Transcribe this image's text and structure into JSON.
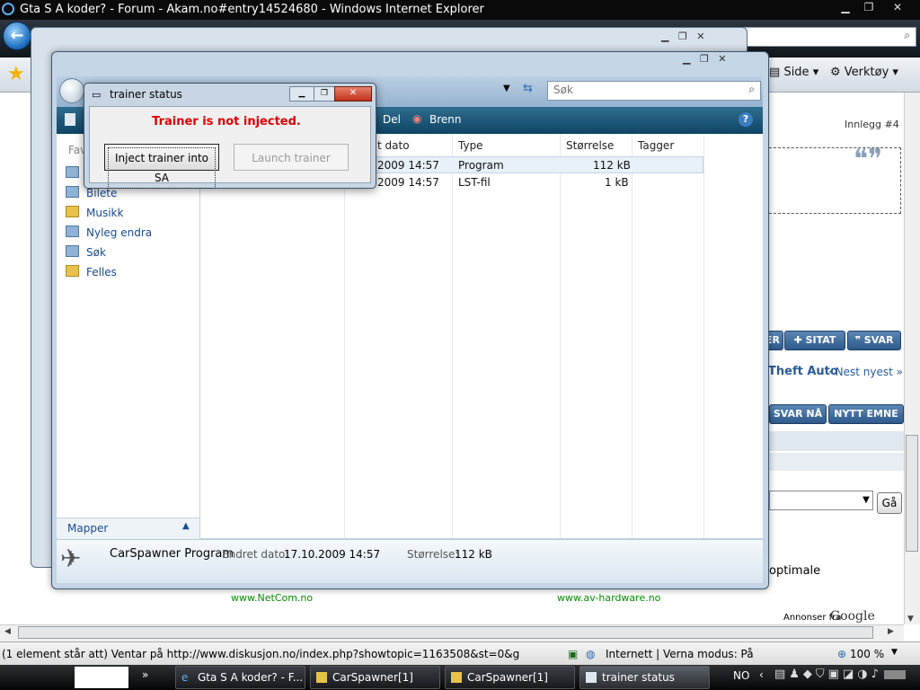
{
  "ie": {
    "title": "Gta S A koder? - Forum - Akam.no#entry14524680 - Windows Internet Explorer",
    "toolbar": {
      "side": "Side",
      "tools": "Verktøy"
    },
    "status_text": "(1 element står att) Ventar på http://www.diskusjon.no/index.php?showtopic=1163508&st=0&g",
    "zone": "Internett | Verna modus: På",
    "zoom": "100 %"
  },
  "page": {
    "innlegg": "Innlegg #4",
    "quote_label": "SITAT",
    "svar_label": "SVAR",
    "er_label": "ER",
    "theft_auto": "Theft Auto",
    "nest_nyest": "· Nest nyest »",
    "svar_na": "SVAR NÅ",
    "nytt_emne": "NYTT EMNE",
    "ga": "Gå",
    "optimale": "optimale",
    "netcom": "www.NetCom.no",
    "avhw": "www.av-hardware.no",
    "annonser": "Annonser fra",
    "google": "Google"
  },
  "explorer": {
    "search_placeholder": "Søk",
    "cmd": {
      "del": "Del",
      "brenn": "Brenn"
    },
    "nav": [
      "Bilete",
      "Musikk",
      "Nyleg endra",
      "Søk",
      "Felles"
    ],
    "nav_fav": "Fav",
    "mapper": "Mapper",
    "columns": [
      "t dato",
      "Type",
      "Størrelse",
      "Tagger"
    ],
    "rows": [
      {
        "date": "2009 14:57",
        "type": "Program",
        "size": "112 kB"
      },
      {
        "date": "2009 14:57",
        "type": "LST-fil",
        "size": "1 kB"
      }
    ],
    "details": {
      "name": "CarSpawner Program",
      "date_label": "Endret dato:",
      "date": "17.10.2009 14:57",
      "size_label": "Størrelse:",
      "size": "112 kB"
    }
  },
  "dialog": {
    "title": "trainer status",
    "message": "Trainer is not injected.",
    "inject_label": "Inject trainer into SA",
    "launch_label": "Launch trainer"
  },
  "taskbar": {
    "tasks": [
      "Gta S A koder? - F...",
      "CarSpawner[1]",
      "CarSpawner[1]",
      "trainer status"
    ],
    "lang": "NO"
  },
  "colors": {
    "error_red": "#dd0000",
    "cmdbar": "#1b5676"
  }
}
